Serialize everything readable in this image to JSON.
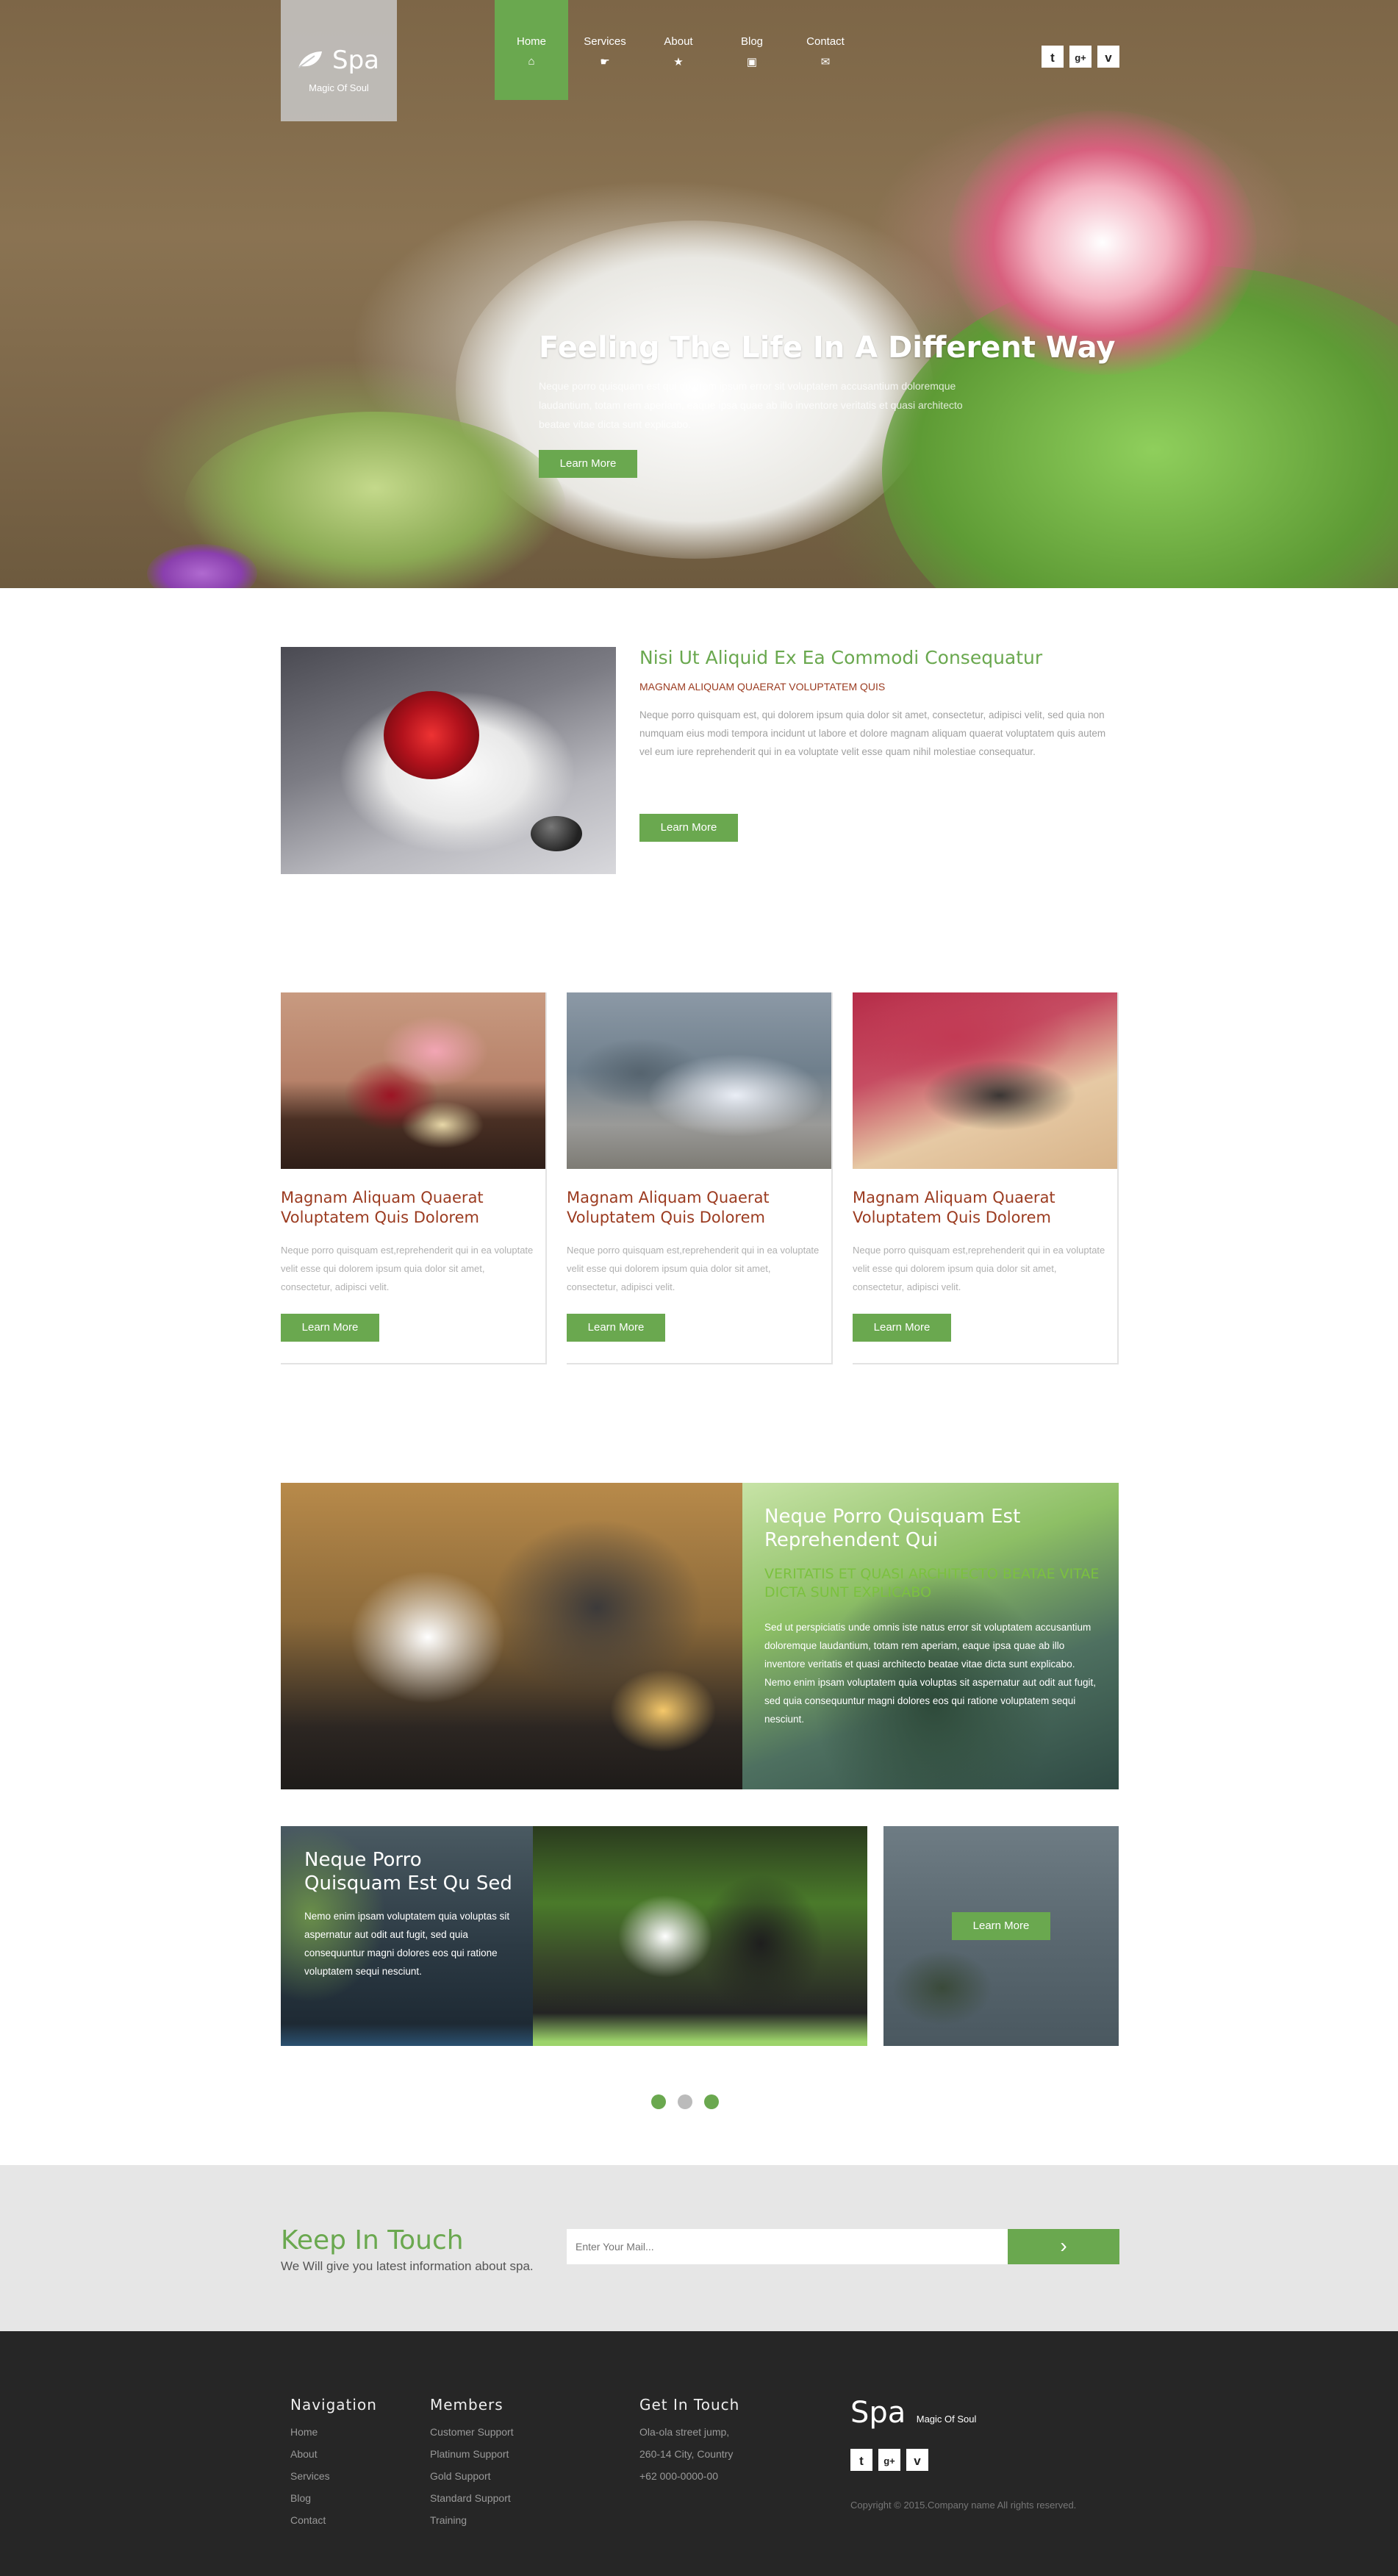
{
  "brand": {
    "name": "Spa",
    "tagline": "Magic Of Soul"
  },
  "nav": [
    {
      "label": "Home",
      "icon": "home-icon",
      "glyph": "⌂",
      "active": true
    },
    {
      "label": "Services",
      "icon": "services-icon",
      "glyph": "☛",
      "active": false
    },
    {
      "label": "About",
      "icon": "star-icon",
      "glyph": "★",
      "active": false
    },
    {
      "label": "Blog",
      "icon": "image-icon",
      "glyph": "▣",
      "active": false
    },
    {
      "label": "Contact",
      "icon": "envelope-icon",
      "glyph": "✉",
      "active": false
    }
  ],
  "social": [
    {
      "name": "twitter-icon",
      "glyph": "t"
    },
    {
      "name": "google-plus-icon",
      "glyph": "g+"
    },
    {
      "name": "vimeo-icon",
      "glyph": "v"
    }
  ],
  "hero": {
    "title": "Feeling The Life In A Different Way",
    "text": "Neque porro quisquam est qui dolorem ipsum error sit voluptatem accusantium doloremque laudantium, totam rem aperiam, eaque ipsa quae ab illo inventore veritatis et quasi architecto beatae vitae dicta sunt explicabo.",
    "button": "Learn More"
  },
  "feature": {
    "title": "Nisi Ut Aliquid Ex Ea Commodi Consequatur",
    "subtitle": "MAGNAM ALIQUAM QUAERAT VOLUPTATEM QUIS",
    "text": "Neque porro quisquam est, qui dolorem ipsum quia dolor sit amet, consectetur, adipisci velit, sed quia non numquam eius modi tempora incidunt ut labore et dolore magnam aliquam quaerat voluptatem quis autem vel eum iure reprehenderit qui in ea voluptate velit esse quam nihil molestiae consequatur.",
    "button": "Learn More"
  },
  "cards": [
    {
      "title": "Magnam Aliquam Quaerat Voluptatem Quis Dolorem",
      "text": "Neque porro quisquam est,reprehenderit qui in ea voluptate velit esse qui dolorem ipsum quia dolor sit amet, consectetur, adipisci velit.",
      "button": "Learn More"
    },
    {
      "title": "Magnam Aliquam Quaerat Voluptatem Quis Dolorem",
      "text": "Neque porro quisquam est,reprehenderit qui in ea voluptate velit esse qui dolorem ipsum quia dolor sit amet, consectetur, adipisci velit.",
      "button": "Learn More"
    },
    {
      "title": "Magnam Aliquam Quaerat Voluptatem Quis Dolorem",
      "text": "Neque porro quisquam est,reprehenderit qui in ea voluptate velit esse qui dolorem ipsum quia dolor sit amet, consectetur, adipisci velit.",
      "button": "Learn More"
    }
  ],
  "gallery": {
    "panel1": {
      "title": "Neque Porro Quisquam Est Reprehendent Qui",
      "subtitle": "VERITATIS ET QUASI ARCHITECTO BEATAE VITAE DICTA SUNT EXPLICABO",
      "text": "Sed ut perspiciatis unde omnis iste natus error sit voluptatem accusantium doloremque laudantium, totam rem aperiam, eaque ipsa quae ab illo inventore veritatis et quasi architecto beatae vitae dicta sunt explicabo. Nemo enim ipsam voluptatem quia voluptas sit aspernatur aut odit aut fugit, sed quia consequuntur magni dolores eos qui ratione voluptatem sequi nesciunt."
    },
    "panel2": {
      "title": "Neque Porro Quisquam Est Qu Sed",
      "text": "Nemo enim ipsam voluptatem quia voluptas sit aspernatur aut odit aut fugit, sed quia consequuntur magni dolores eos qui ratione voluptatem sequi nesciunt."
    },
    "button": "Learn More"
  },
  "newsletter": {
    "title": "Keep In Touch",
    "subtitle": "We Will give you latest information about spa.",
    "placeholder": "Enter Your Mail...",
    "submit": "›"
  },
  "footer": {
    "navigation": {
      "heading": "Navigation",
      "items": [
        "Home",
        "About",
        "Services",
        "Blog",
        "Contact"
      ]
    },
    "members": {
      "heading": "Members",
      "items": [
        "Customer Support",
        "Platinum Support",
        "Gold Support",
        "Standard Support",
        "Training"
      ]
    },
    "contact": {
      "heading": "Get In Touch",
      "items": [
        "Ola-ola street jump,",
        "260-14 City, Country",
        "+62 000-0000-00"
      ]
    },
    "brand": {
      "name": "Spa",
      "tagline": "Magic Of Soul"
    },
    "copyright": "Copyright © 2015.Company name All rights reserved."
  },
  "colors": {
    "accent": "#6aa84f",
    "heading_brown": "#9b3b20",
    "footer_bg": "#262626",
    "newsletter_bg": "#e6e6e6"
  }
}
